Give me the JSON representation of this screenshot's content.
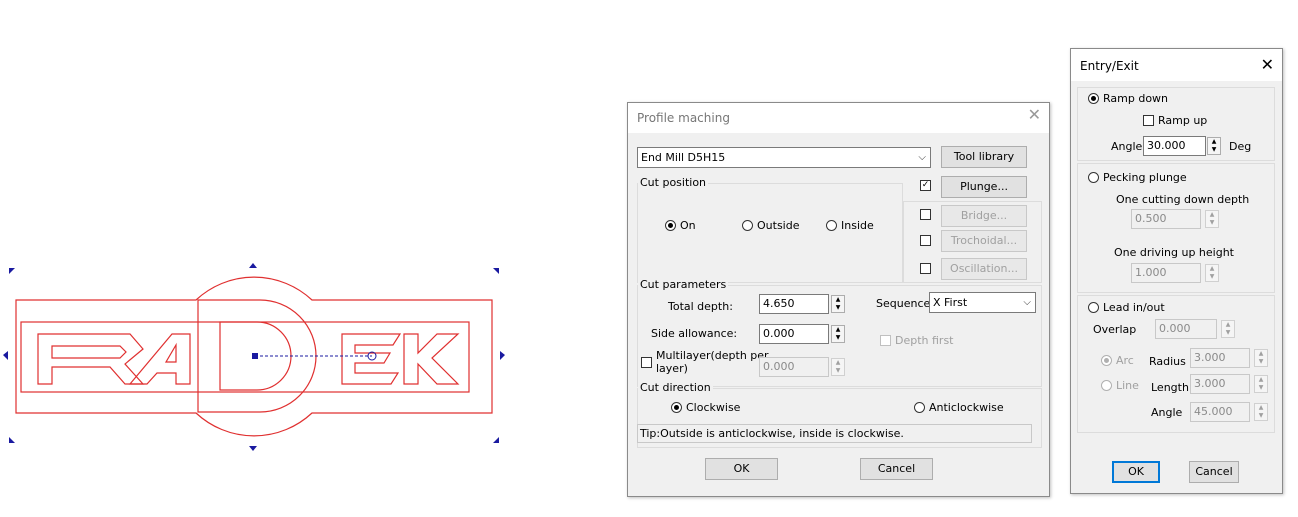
{
  "canvas": {
    "logo_text": "RADEK",
    "outline_color": "#e03030",
    "handle_color": "#1a1aa0"
  },
  "profile": {
    "title": "Profile maching",
    "close_icon": "close-icon",
    "tool_select": "End Mill D5H15",
    "tool_library_label": "Tool library",
    "cut_position_label": "Cut position",
    "plunge_label": "Plunge...",
    "bridge_label": "Bridge...",
    "trochoidal_label": "Trochoidal...",
    "oscillation_label": "Oscillation...",
    "position_on": "On",
    "position_outside": "Outside",
    "position_inside": "Inside",
    "cut_parameters_label": "Cut parameters",
    "total_depth_label": "Total depth:",
    "total_depth_value": "4.650",
    "sequence_label": "Sequence",
    "sequence_value": "X First",
    "side_allowance_label": "Side allowance:",
    "side_allowance_value": "0.000",
    "depth_first_label": "Depth first",
    "multilayer_label_1": "Multilayer(depth per",
    "multilayer_label_2": "layer)",
    "multilayer_value": "0.000",
    "cut_direction_label": "Cut direction",
    "clockwise_label": "Clockwise",
    "anticlockwise_label": "Anticlockwise",
    "tip": "Tip:Outside is anticlockwise, inside is clockwise.",
    "ok_label": "OK",
    "cancel_label": "Cancel"
  },
  "entry": {
    "title": "Entry/Exit",
    "ramp_down_label": "Ramp down",
    "ramp_up_label": "Ramp up",
    "angle_label": "Angle",
    "angle_value": "30.000",
    "deg_label": "Deg",
    "pecking_label": "Pecking plunge",
    "one_cut_down_label": "One cutting down depth",
    "one_cut_down_value": "0.500",
    "one_drive_up_label": "One driving up height",
    "one_drive_up_value": "1.000",
    "lead_label": "Lead in/out",
    "overlap_label": "Overlap",
    "overlap_value": "0.000",
    "arc_label": "Arc",
    "radius_label": "Radius",
    "radius_value": "3.000",
    "line_label": "Line",
    "length_label": "Length",
    "length_value": "3.000",
    "lead_angle_label": "Angle",
    "lead_angle_value": "45.000",
    "ok_label": "OK",
    "cancel_label": "Cancel"
  }
}
